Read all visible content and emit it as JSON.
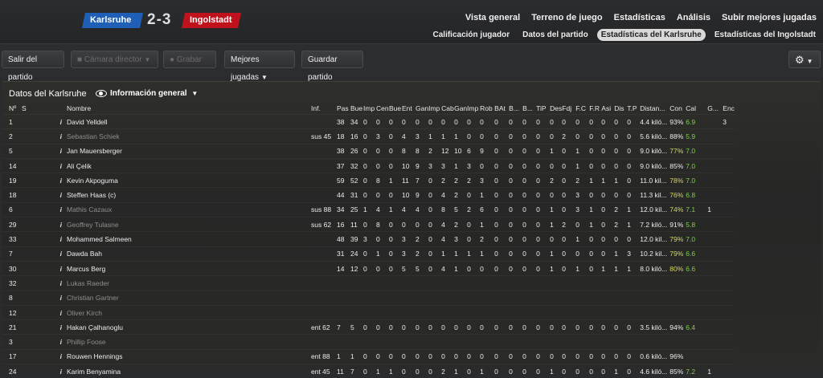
{
  "match": {
    "home_team": "Karlsruhe",
    "away_team": "Ingolstadt",
    "score": "2-3",
    "home_color": "#1f5fb5",
    "away_color": "#c0121d"
  },
  "nav": {
    "main": [
      "Vista general",
      "Terreno de juego",
      "Estadísticas",
      "Análisis",
      "Subir mejores jugadas"
    ],
    "sub": [
      "Calificación jugador",
      "Datos del partido",
      "Estadísticas del Karlsruhe",
      "Estadísticas del Ingolstadt"
    ],
    "active_sub": 2
  },
  "toolbar": {
    "exit_label": "Salir del partido",
    "camera_label": "Cámara director",
    "record_label": "Grabar",
    "highlights_label": "Mejores jugadas",
    "save_label": "Guardar partido",
    "settings_icon": "gear-icon"
  },
  "panel": {
    "title": "Datos del Karlsruhe",
    "view_label": "Información general"
  },
  "columns": [
    "Nº",
    "S",
    "Nombre",
    "Inf.",
    "Pas",
    "Bue",
    "Imp",
    "Cen",
    "Bue",
    "Ent",
    "Gan",
    "Imp",
    "Cab",
    "Gan",
    "Imp",
    "Rob",
    "BAt",
    "B...",
    "B...",
    "TiP",
    "Des",
    "Fdj",
    "F.C",
    "F.R",
    "Asi",
    "Dis",
    "T.P",
    "Distan...",
    "Con",
    "Cal",
    "G...",
    "Enc"
  ],
  "rows": [
    {
      "num": "1",
      "name": "David Yelldell",
      "inf": "",
      "vals": [
        "38",
        "34",
        "0",
        "0",
        "0",
        "0",
        "0",
        "0",
        "0",
        "0",
        "0",
        "0",
        "0",
        "0",
        "0",
        "0",
        "0",
        "0",
        "0",
        "0",
        "0",
        "0",
        "0"
      ],
      "dist": "4.4 kiló...",
      "con": "93%",
      "cal": "6.9",
      "g": "",
      "enc": "3",
      "dim": false,
      "con_c": "",
      "cal_c": "green"
    },
    {
      "num": "2",
      "name": "Sebastian Schiek",
      "inf": "sus 45",
      "vals": [
        "18",
        "16",
        "0",
        "3",
        "0",
        "4",
        "3",
        "1",
        "1",
        "1",
        "0",
        "0",
        "0",
        "0",
        "0",
        "0",
        "0",
        "2",
        "0",
        "0",
        "0",
        "0",
        "0"
      ],
      "dist": "5.6 kiló...",
      "con": "88%",
      "cal": "5.9",
      "g": "",
      "enc": "",
      "dim": true,
      "con_c": "",
      "cal_c": "green"
    },
    {
      "num": "5",
      "name": "Jan Mauersberger",
      "inf": "",
      "vals": [
        "38",
        "26",
        "0",
        "0",
        "0",
        "8",
        "8",
        "2",
        "12",
        "10",
        "6",
        "9",
        "0",
        "0",
        "0",
        "0",
        "1",
        "0",
        "1",
        "0",
        "0",
        "0",
        "0"
      ],
      "dist": "9.0 kiló...",
      "con": "77%",
      "cal": "7.0",
      "g": "",
      "enc": "",
      "dim": false,
      "con_c": "yellow",
      "cal_c": "green"
    },
    {
      "num": "14",
      "name": "Ali Çelik",
      "inf": "",
      "vals": [
        "37",
        "32",
        "0",
        "0",
        "0",
        "10",
        "9",
        "3",
        "3",
        "1",
        "3",
        "0",
        "0",
        "0",
        "0",
        "0",
        "0",
        "0",
        "1",
        "0",
        "0",
        "0",
        "0"
      ],
      "dist": "9.0 kiló...",
      "con": "85%",
      "cal": "7.0",
      "g": "",
      "enc": "",
      "dim": false,
      "con_c": "",
      "cal_c": "green"
    },
    {
      "num": "19",
      "name": "Kevin Akpoguma",
      "inf": "",
      "vals": [
        "59",
        "52",
        "0",
        "8",
        "1",
        "11",
        "7",
        "0",
        "2",
        "2",
        "2",
        "3",
        "0",
        "0",
        "0",
        "0",
        "2",
        "0",
        "2",
        "1",
        "1",
        "1",
        "0"
      ],
      "dist": "11.0 kil...",
      "con": "78%",
      "cal": "7.0",
      "g": "",
      "enc": "",
      "dim": false,
      "con_c": "yellow",
      "cal_c": "green"
    },
    {
      "num": "18",
      "name": "Steffen Haas (c)",
      "inf": "",
      "vals": [
        "44",
        "31",
        "0",
        "0",
        "0",
        "10",
        "9",
        "0",
        "4",
        "2",
        "0",
        "1",
        "0",
        "0",
        "0",
        "0",
        "0",
        "0",
        "3",
        "0",
        "0",
        "0",
        "0"
      ],
      "dist": "11.3 kil...",
      "con": "76%",
      "cal": "6.8",
      "g": "",
      "enc": "",
      "dim": false,
      "con_c": "yellow",
      "cal_c": "green"
    },
    {
      "num": "6",
      "name": "Mathis Cazaux",
      "inf": "sus 88",
      "vals": [
        "34",
        "25",
        "1",
        "4",
        "1",
        "4",
        "4",
        "0",
        "8",
        "5",
        "2",
        "6",
        "0",
        "0",
        "0",
        "0",
        "1",
        "0",
        "3",
        "1",
        "0",
        "2",
        "1"
      ],
      "dist": "12.0 kil...",
      "con": "74%",
      "cal": "7.1",
      "g": "1",
      "enc": "",
      "dim": true,
      "con_c": "yellow",
      "cal_c": "green"
    },
    {
      "num": "29",
      "name": "Geoffrey Tulasne",
      "inf": "sus 62",
      "vals": [
        "16",
        "11",
        "0",
        "8",
        "0",
        "0",
        "0",
        "0",
        "4",
        "2",
        "0",
        "1",
        "0",
        "0",
        "0",
        "0",
        "1",
        "2",
        "0",
        "1",
        "0",
        "2",
        "1"
      ],
      "dist": "7.2 kiló...",
      "con": "91%",
      "cal": "5.8",
      "g": "",
      "enc": "",
      "dim": true,
      "con_c": "",
      "cal_c": "green"
    },
    {
      "num": "33",
      "name": "Mohammed Salmeen",
      "inf": "",
      "vals": [
        "48",
        "39",
        "3",
        "0",
        "0",
        "3",
        "2",
        "0",
        "4",
        "3",
        "0",
        "2",
        "0",
        "0",
        "0",
        "0",
        "0",
        "0",
        "1",
        "0",
        "0",
        "0",
        "0"
      ],
      "dist": "12.0 kil...",
      "con": "79%",
      "cal": "7.0",
      "g": "",
      "enc": "",
      "dim": false,
      "con_c": "yellow",
      "cal_c": "green"
    },
    {
      "num": "7",
      "name": "Dawda Bah",
      "inf": "",
      "vals": [
        "31",
        "24",
        "0",
        "1",
        "0",
        "3",
        "2",
        "0",
        "1",
        "1",
        "1",
        "1",
        "0",
        "0",
        "0",
        "0",
        "1",
        "0",
        "0",
        "0",
        "0",
        "1",
        "3"
      ],
      "dist": "10.2 kil...",
      "con": "79%",
      "cal": "6.6",
      "g": "",
      "enc": "",
      "dim": false,
      "con_c": "yellow",
      "cal_c": "green"
    },
    {
      "num": "30",
      "name": "Marcus Berg",
      "inf": "",
      "vals": [
        "14",
        "12",
        "0",
        "0",
        "0",
        "5",
        "5",
        "0",
        "4",
        "1",
        "0",
        "0",
        "0",
        "0",
        "0",
        "0",
        "1",
        "0",
        "1",
        "0",
        "1",
        "1",
        "1"
      ],
      "dist": "8.0 kiló...",
      "con": "80%",
      "cal": "6.6",
      "g": "",
      "enc": "",
      "dim": false,
      "con_c": "yellow",
      "cal_c": "green"
    },
    {
      "num": "32",
      "name": "Lukas Raeder",
      "inf": "",
      "vals": [],
      "dist": "",
      "con": "",
      "cal": "",
      "g": "",
      "enc": "",
      "dim": true,
      "con_c": "",
      "cal_c": ""
    },
    {
      "num": "8",
      "name": "Christian Gartner",
      "inf": "",
      "vals": [],
      "dist": "",
      "con": "",
      "cal": "",
      "g": "",
      "enc": "",
      "dim": true,
      "con_c": "",
      "cal_c": ""
    },
    {
      "num": "12",
      "name": "Oliver Kirch",
      "inf": "",
      "vals": [],
      "dist": "",
      "con": "",
      "cal": "",
      "g": "",
      "enc": "",
      "dim": true,
      "con_c": "",
      "cal_c": ""
    },
    {
      "num": "21",
      "name": "Hakan Çalhanoglu",
      "inf": "ent 62",
      "vals": [
        "7",
        "5",
        "0",
        "0",
        "0",
        "0",
        "0",
        "0",
        "0",
        "0",
        "0",
        "0",
        "0",
        "0",
        "0",
        "0",
        "0",
        "0",
        "0",
        "0",
        "0",
        "0",
        "0"
      ],
      "dist": "3.5 kiló...",
      "con": "94%",
      "cal": "6.4",
      "g": "",
      "enc": "",
      "dim": false,
      "con_c": "",
      "cal_c": "green"
    },
    {
      "num": "3",
      "name": "Phillip Foose",
      "inf": "",
      "vals": [],
      "dist": "",
      "con": "",
      "cal": "",
      "g": "",
      "enc": "",
      "dim": true,
      "con_c": "",
      "cal_c": ""
    },
    {
      "num": "17",
      "name": "Rouwen Hennings",
      "inf": "ent 88",
      "vals": [
        "1",
        "1",
        "0",
        "0",
        "0",
        "0",
        "0",
        "0",
        "0",
        "0",
        "0",
        "0",
        "0",
        "0",
        "0",
        "0",
        "0",
        "0",
        "0",
        "0",
        "0",
        "0",
        "0"
      ],
      "dist": "0.6 kiló...",
      "con": "96%",
      "cal": "",
      "g": "",
      "enc": "",
      "dim": false,
      "con_c": "",
      "cal_c": ""
    },
    {
      "num": "24",
      "name": "Karim Benyamina",
      "inf": "ent 45",
      "vals": [
        "11",
        "7",
        "0",
        "1",
        "1",
        "0",
        "0",
        "0",
        "2",
        "1",
        "0",
        "1",
        "0",
        "0",
        "0",
        "0",
        "1",
        "0",
        "0",
        "0",
        "0",
        "1",
        "0"
      ],
      "dist": "4.6 kiló...",
      "con": "85%",
      "cal": "7.2",
      "g": "1",
      "enc": "",
      "dim": false,
      "con_c": "",
      "cal_c": "green"
    }
  ]
}
